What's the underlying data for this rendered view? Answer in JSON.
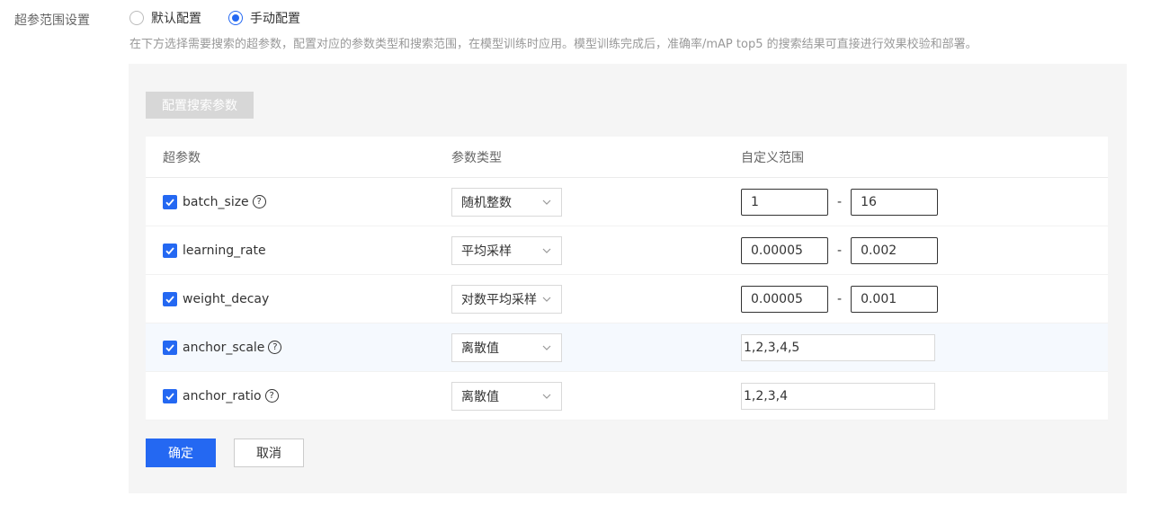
{
  "field_label": "超参范围设置",
  "mode": {
    "options": [
      {
        "label": "默认配置",
        "checked": false
      },
      {
        "label": "手动配置",
        "checked": true
      }
    ]
  },
  "hint": "在下方选择需要搜索的超参数，配置对应的参数类型和搜索范围，在模型训练时应用。模型训练完成后，准确率/mAP top5 的搜索结果可直接进行效果校验和部署。",
  "config_button": "配置搜索参数",
  "table": {
    "headers": [
      "超参数",
      "参数类型",
      "自定义范围"
    ],
    "rows": [
      {
        "name": "batch_size",
        "help": true,
        "checked": true,
        "type": "随机整数",
        "range_kind": "minmax",
        "min": "1",
        "max": "16"
      },
      {
        "name": "learning_rate",
        "help": false,
        "checked": true,
        "type": "平均采样",
        "range_kind": "minmax",
        "min": "0.00005",
        "max": "0.002"
      },
      {
        "name": "weight_decay",
        "help": false,
        "checked": true,
        "type": "对数平均采样",
        "range_kind": "minmax",
        "min": "0.00005",
        "max": "0.001"
      },
      {
        "name": "anchor_scale",
        "help": true,
        "checked": true,
        "type": "离散值",
        "range_kind": "list",
        "list": "1,2,3,4,5"
      },
      {
        "name": "anchor_ratio",
        "help": true,
        "checked": true,
        "type": "离散值",
        "range_kind": "list",
        "list": "1,2,3,4"
      }
    ],
    "range_separator": "-"
  },
  "help_icon": {
    "glyph": "?"
  },
  "buttons": {
    "ok": "确定",
    "cancel": "取消"
  },
  "colors": {
    "primary": "#2468f2",
    "disabled": "#d7d7d7",
    "panel_bg": "#f5f5f5"
  }
}
